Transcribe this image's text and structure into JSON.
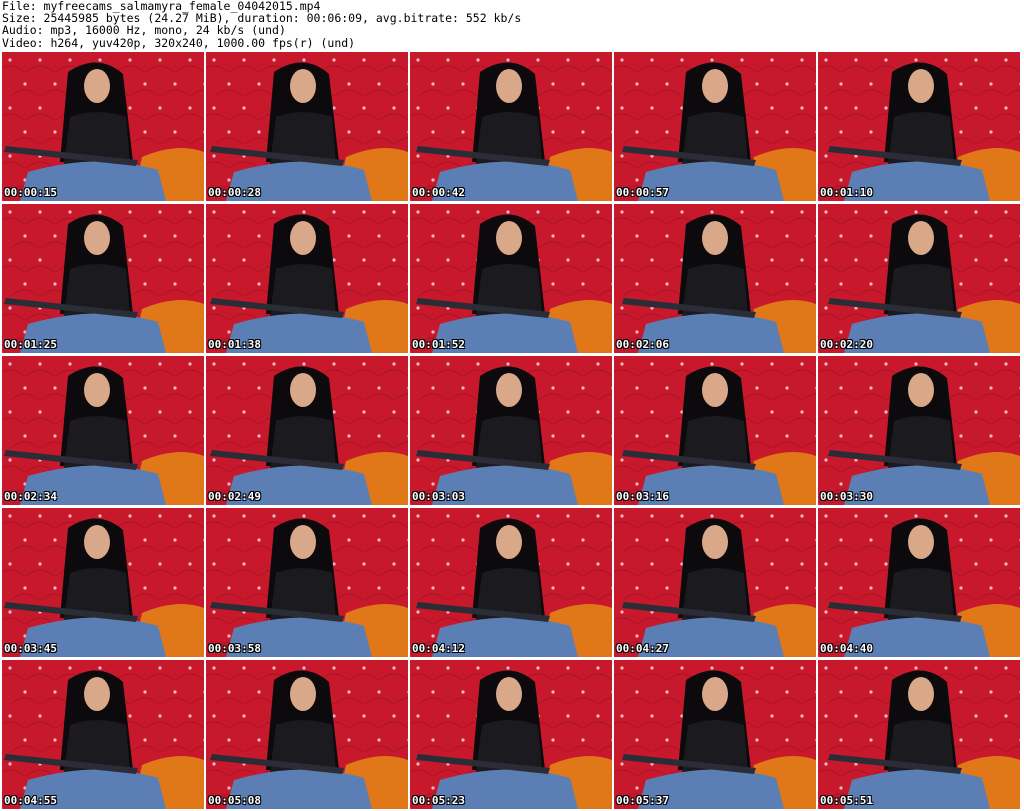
{
  "info": {
    "file": "File: myfreecams_salmamyra_female_04042015.mp4",
    "size": "Size: 25445985 bytes (24.27 MiB), duration: 00:06:09, avg.bitrate: 552 kb/s",
    "audio": "Audio: mp3, 16000 Hz, mono, 24 kb/s (und)",
    "video": "Video: h264, yuv420p, 320x240, 1000.00 fps(r) (und)"
  },
  "colors": {
    "sofa": "#c8182c",
    "sofa_dark": "#8e0f1f",
    "orange_cushion": "#e0781a",
    "jeans": "#5b7fb5",
    "top": "#1a1a1f",
    "hair": "#0c0a0c",
    "skin": "#d9a888",
    "keyboard": "#2a2d36"
  },
  "thumbnails": [
    {
      "time": "00:00:15"
    },
    {
      "time": "00:00:28"
    },
    {
      "time": "00:00:42"
    },
    {
      "time": "00:00:57"
    },
    {
      "time": "00:01:10"
    },
    {
      "time": "00:01:25"
    },
    {
      "time": "00:01:38"
    },
    {
      "time": "00:01:52"
    },
    {
      "time": "00:02:06"
    },
    {
      "time": "00:02:20"
    },
    {
      "time": "00:02:34"
    },
    {
      "time": "00:02:49"
    },
    {
      "time": "00:03:03"
    },
    {
      "time": "00:03:16"
    },
    {
      "time": "00:03:30"
    },
    {
      "time": "00:03:45"
    },
    {
      "time": "00:03:58"
    },
    {
      "time": "00:04:12"
    },
    {
      "time": "00:04:27"
    },
    {
      "time": "00:04:40"
    },
    {
      "time": "00:04:55"
    },
    {
      "time": "00:05:08"
    },
    {
      "time": "00:05:23"
    },
    {
      "time": "00:05:37"
    },
    {
      "time": "00:05:51"
    }
  ]
}
